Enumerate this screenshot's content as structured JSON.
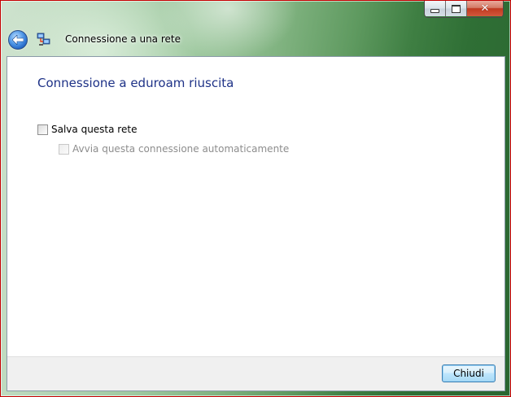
{
  "window": {
    "title": "Connessione a una rete",
    "caption": {
      "close_glyph": "✕"
    }
  },
  "content": {
    "heading": "Connessione a eduroam riuscita",
    "save_network": {
      "label": "Salva questa rete",
      "checked": false
    },
    "auto_connect": {
      "label": "Avvia questa connessione automaticamente",
      "checked": false,
      "enabled": false
    }
  },
  "footer": {
    "close_button": "Chiudi"
  },
  "colors": {
    "heading": "#1e3287",
    "window_border": "#c40000",
    "aero_glass": "#5f9a60",
    "button_border": "#3c7fb1"
  },
  "icons": {
    "back": "back-arrow-icon",
    "title": "network-icon",
    "minimize": "minimize-icon",
    "maximize": "maximize-icon",
    "close": "close-icon"
  }
}
